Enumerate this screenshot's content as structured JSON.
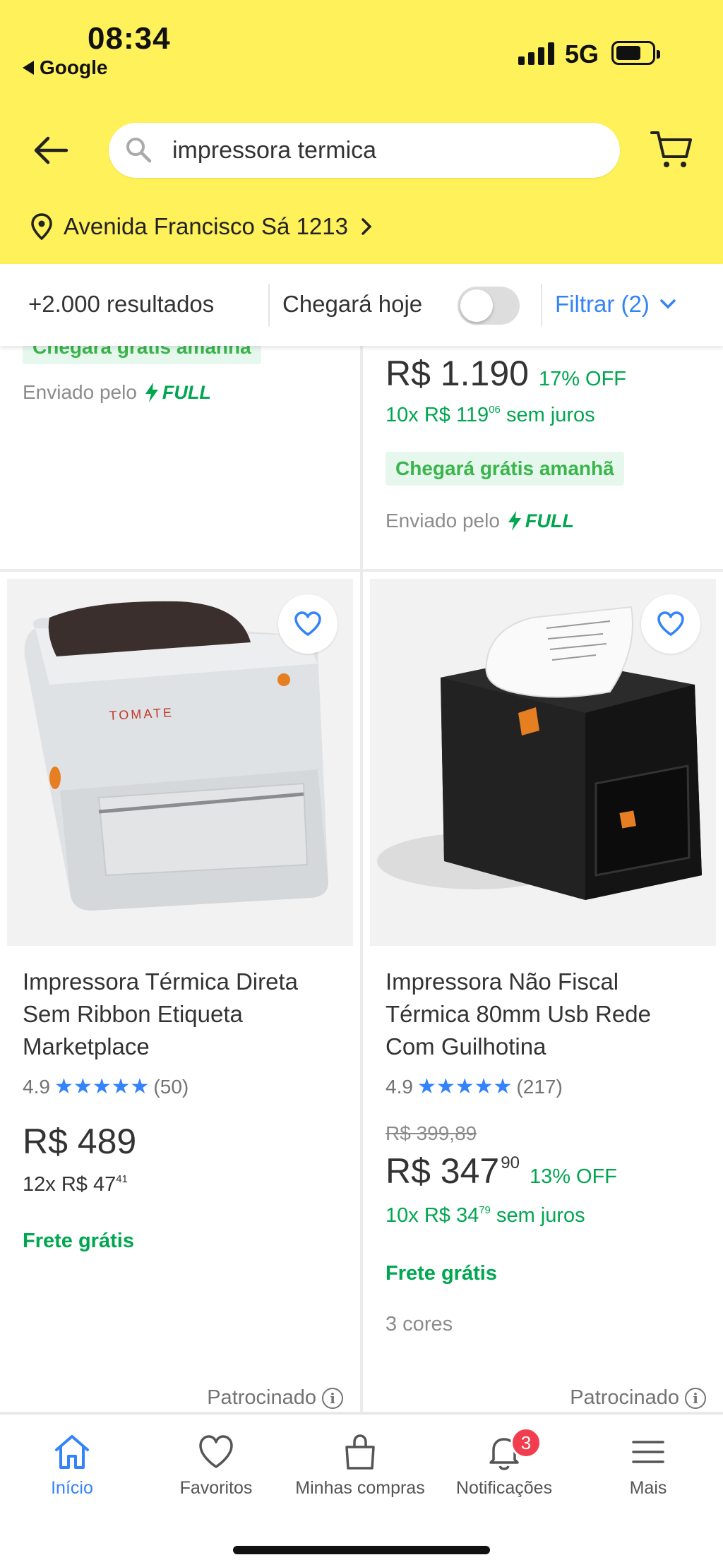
{
  "status_bar": {
    "time": "08:34",
    "back_app": "Google",
    "network": "5G"
  },
  "search": {
    "query": "impressora termica"
  },
  "location": {
    "address": "Avenida Francisco Sá 1213"
  },
  "filter_bar": {
    "results": "+2.000 resultados",
    "arrive_today": "Chegará hoje",
    "arrive_today_on": false,
    "filter_label": "Filtrar (2)"
  },
  "partial_cards": {
    "left": {
      "shipping_tag": "Chegará grátis amanhã",
      "sent_by": "Enviado pelo",
      "full": "FULL"
    },
    "right": {
      "price": "R$ 1.190",
      "discount": "17% OFF",
      "installments_prefix": "10x R$ 119",
      "installments_cents": "06",
      "installments_suffix": "sem juros",
      "shipping_tag": "Chegará grátis amanhã",
      "sent_by": "Enviado pelo",
      "full": "FULL"
    }
  },
  "products": [
    {
      "title": "Impressora Térmica Direta Sem Ribbon Etiqueta Marketplace",
      "rating": "4.9",
      "stars": 5,
      "reviews": "(50)",
      "price": "R$ 489",
      "installments_prefix": "12x R$ 47",
      "installments_cents": "41",
      "shipping": "Frete grátis",
      "sponsored": "Patrocinado",
      "brand_print": "TOMATE",
      "image_icon": "label-printer-image"
    },
    {
      "title": "Impressora Não Fiscal Térmica 80mm Usb Rede Com Guilhotina",
      "rating": "4.9",
      "stars": 5,
      "reviews": "(217)",
      "old_price": "R$ 399,89",
      "price": "R$ 347",
      "price_cents": "90",
      "discount": "13% OFF",
      "installments_prefix": "10x R$ 34",
      "installments_cents": "79",
      "installments_suffix": "sem juros",
      "shipping": "Frete grátis",
      "colors": "3 cores",
      "sponsored": "Patrocinado",
      "image_icon": "receipt-printer-image"
    }
  ],
  "bottom_nav": [
    {
      "label": "Início",
      "icon": "home-icon",
      "active": true
    },
    {
      "label": "Favoritos",
      "icon": "heart-icon"
    },
    {
      "label": "Minhas compras",
      "icon": "bag-icon"
    },
    {
      "label": "Notificações",
      "icon": "bell-icon",
      "badge": "3"
    },
    {
      "label": "Mais",
      "icon": "menu-icon"
    }
  ],
  "colors": {
    "header_yellow": "#fff159",
    "accent_blue": "#3483fa",
    "green": "#00a650",
    "badge_red": "#f23d4f"
  }
}
